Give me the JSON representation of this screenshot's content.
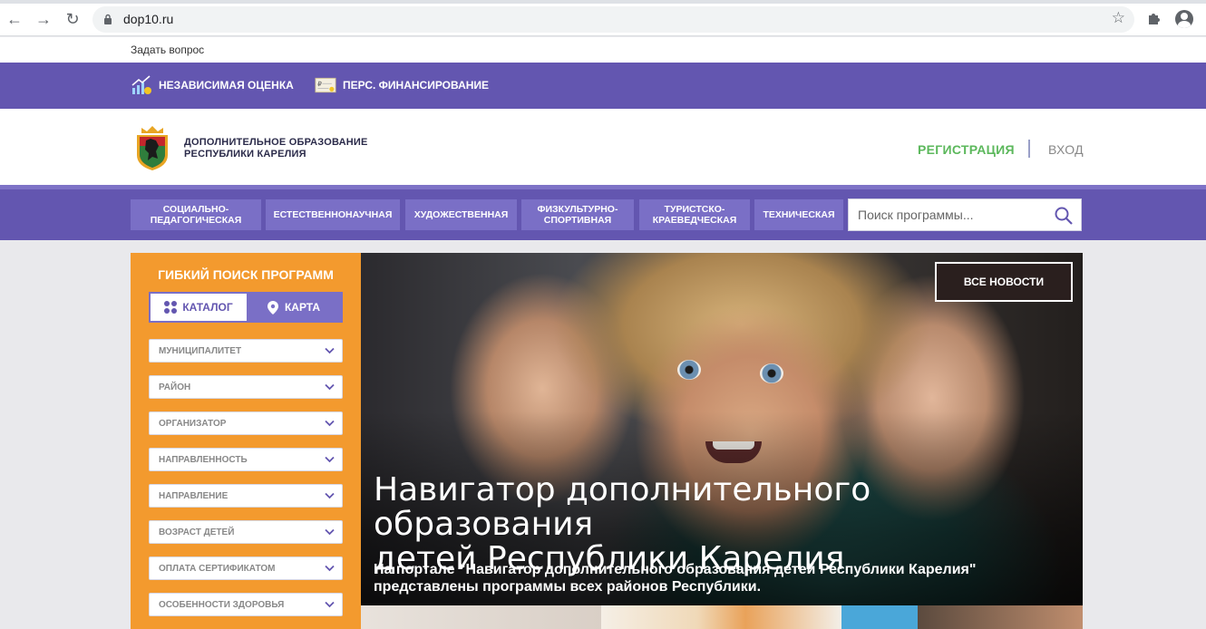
{
  "browser": {
    "url": "dop10.ru",
    "back_icon": "←",
    "forward_icon": "→",
    "reload_icon": "↻",
    "star_icon": "☆"
  },
  "util": {
    "ask_question": "Задать вопрос"
  },
  "topbar": {
    "items": [
      {
        "label": "Независимая оценка",
        "icon": "chart-growth-icon"
      },
      {
        "label": "Перс. финансирование",
        "icon": "certificate-icon"
      }
    ]
  },
  "header": {
    "brand_line1": "ДОПОЛНИТЕЛЬНОЕ ОБРАЗОВАНИЕ",
    "brand_line2": "РЕСПУБЛИКИ КАРЕЛИЯ",
    "register": "РЕГИСТРАЦИЯ",
    "login": "ВХОД"
  },
  "categories": [
    {
      "line1": "Социально-",
      "line2": "педагогическая"
    },
    {
      "line1": "Естественнонаучная",
      "line2": ""
    },
    {
      "line1": "Художественная",
      "line2": ""
    },
    {
      "line1": "Физкультурно-",
      "line2": "спортивная"
    },
    {
      "line1": "Туристско-",
      "line2": "краеведческая"
    },
    {
      "line1": "Техническая",
      "line2": ""
    }
  ],
  "search": {
    "placeholder": "Поиск программы..."
  },
  "filter": {
    "title": "Гибкий поиск программ",
    "toggle_catalog": "КАТАЛОГ",
    "toggle_map": "КАРТА",
    "selects": [
      "Муниципалитет",
      "Район",
      "Организатор",
      "Направленность",
      "Направление",
      "Возраст детей",
      "Оплата сертификатом",
      "Особенности здоровья"
    ]
  },
  "hero": {
    "news_button": "Все новости",
    "title_line1": "Навигатор дополнительного образования",
    "title_line2": "детей Республики Карелия",
    "text_line1": "На портале \"Навигатор дополнительного образования детей Республики Карелия\"",
    "text_line2": "представлены программы всех районов Республики."
  },
  "colors": {
    "purple": "#6356b0",
    "purple_light": "#7a6fc6",
    "orange": "#f39a2e",
    "green": "#5cb85c"
  }
}
